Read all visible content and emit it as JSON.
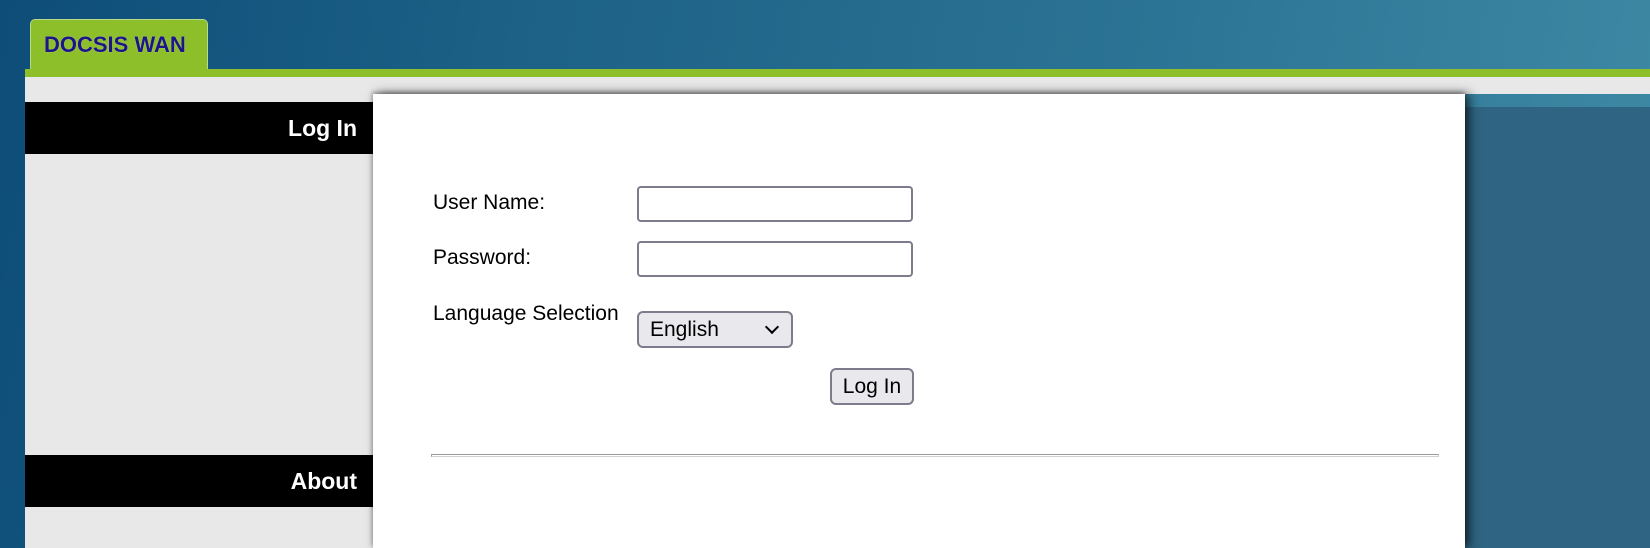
{
  "header": {
    "tab_label": "DOCSIS WAN"
  },
  "sidebar": {
    "sections": [
      {
        "label": "Log In"
      },
      {
        "label": "About"
      }
    ]
  },
  "login_form": {
    "username_label": "User Name:",
    "username_value": "",
    "password_label": "Password:",
    "password_value": "",
    "language_label": "Language Selection",
    "language_selected": "English",
    "submit_label": "Log In"
  },
  "colors": {
    "accent_green": "#8cbf2a",
    "tab_text": "#1c1488",
    "side_panel": "#2f6582",
    "background_blue": "#1d6186"
  }
}
